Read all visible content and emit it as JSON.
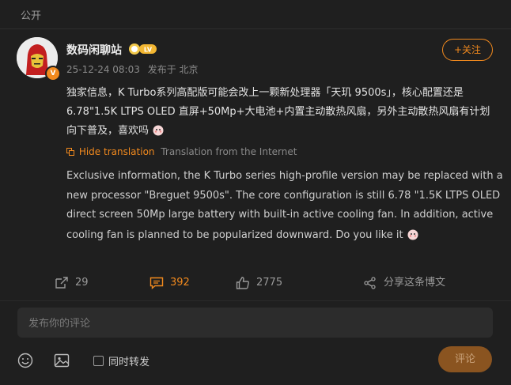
{
  "header": {
    "visibility_label": "公开"
  },
  "author": {
    "name": "数码闲聊站",
    "level": "LV",
    "verified_mark": "V",
    "timestamp": "25-12-24 08:03",
    "location": "发布于 北京"
  },
  "follow_label": "+关注",
  "post": {
    "text": "独家信息，K Turbo系列高配版可能会改上一颗新处理器「天玑 9500s」，核心配置还是 6.78\"1.5K LTPS OLED 直屏+50Mp+大电池+内置主动散热风扇，另外主动散热风扇有计划向下普及，喜欢吗"
  },
  "translation": {
    "hide_label": "Hide translation",
    "source_label": "Translation from the Internet",
    "text": "Exclusive information, the K Turbo series high-profile version may be replaced with a new processor \"Breguet 9500s\". The core configuration is still 6.78 \"1.5K LTPS OLED direct screen 50Mp large battery with built-in active cooling fan. In addition, active cooling fan is planned to be popularized downward. Do you like it"
  },
  "actions": {
    "repost_count": "29",
    "comment_count": "392",
    "like_count": "2775",
    "share_label": "分享这条博文"
  },
  "comment": {
    "placeholder": "发布你的评论",
    "repost_toggle_label": "同时转发",
    "submit_label": "评论"
  },
  "colors": {
    "accent": "#f28a1e",
    "background": "#1f1f1f"
  },
  "icons": [
    "repost-icon",
    "comment-icon",
    "like-icon",
    "share-icon",
    "emoji-icon",
    "image-icon"
  ]
}
